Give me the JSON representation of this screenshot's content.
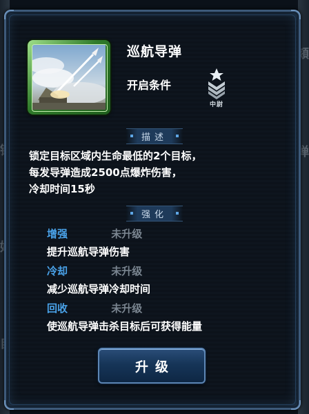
{
  "background": {
    "right_glyphs": [
      "頦",
      "弹"
    ],
    "left_glyphs": [
      "镜",
      "姑",
      "自"
    ]
  },
  "skill": {
    "name": "巡航导弹",
    "unlock_label": "开启条件",
    "rank_label": "中尉",
    "icon": "cruise-missile-art"
  },
  "description": {
    "heading": "描述",
    "lines": [
      "锁定目标区域内生命最低的2个目标，",
      "每发导弹造成2500点爆炸伤害，",
      "冷却时间15秒"
    ]
  },
  "enhance": {
    "heading": "强化",
    "items": [
      {
        "name": "增强",
        "status": "未升级",
        "effect": "提升巡航导弹伤害"
      },
      {
        "name": "冷却",
        "status": "未升级",
        "effect": "减少巡航导弹冷却时间"
      },
      {
        "name": "回收",
        "status": "未升级",
        "effect": "使巡航导弹击杀目标后可获得能量"
      }
    ]
  },
  "upgrade_button": "升级",
  "colors": {
    "accent_blue": "#4aa3ea",
    "frame": "#3d5a7a",
    "card_green": "#2f7a2a",
    "status_gray": "#7a8590"
  }
}
